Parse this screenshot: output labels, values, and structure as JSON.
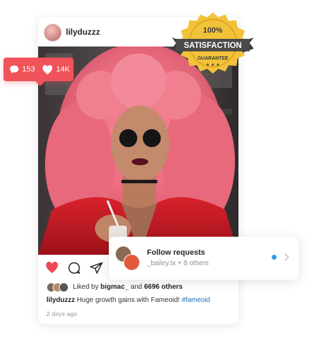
{
  "post": {
    "username": "lilyduzzz",
    "liked_by_prefix": "Liked by",
    "liked_by_user": "bigmac_",
    "liked_by_and": "and",
    "liked_by_count": "6696",
    "liked_by_suffix": "others",
    "caption_user": "lilyduzzz",
    "caption_text": "Huge growth gains with Fameoid!",
    "caption_hashtag": "#fameoid",
    "time_ago": "2 days ago"
  },
  "stats_badge": {
    "comment_count": "153",
    "like_count": "14K",
    "color": "#f0535a"
  },
  "seal": {
    "top_text": "100%",
    "banner_text": "SATISFACTION",
    "bottom_text": "GUARANTEE",
    "gold": "#f2c23a",
    "ribbon": "#4a4a4a"
  },
  "follow_requests": {
    "title": "Follow requests",
    "subtitle": "_bailey.tx + 8 others",
    "dot_color": "#2b9be8"
  },
  "icons": [
    "heart-icon",
    "comment-icon",
    "share-icon",
    "chevron-right-icon"
  ],
  "colors": {
    "like_red": "#ed4956",
    "link_blue": "#1d6fb8"
  }
}
